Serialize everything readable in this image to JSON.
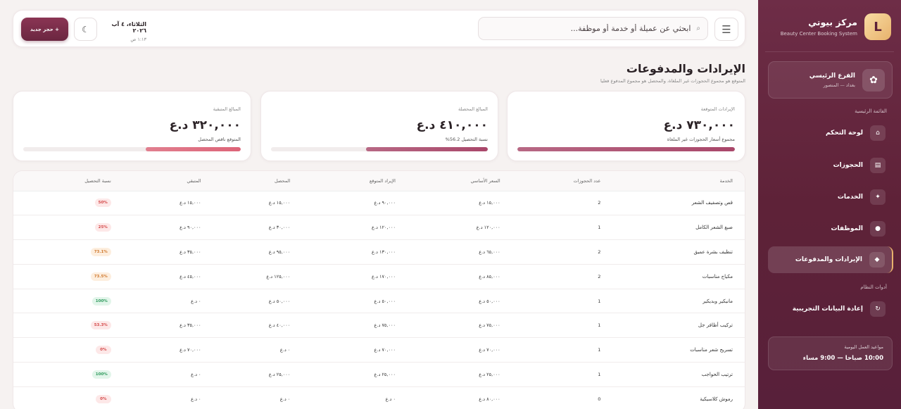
{
  "brand": {
    "name": "مركز بيوتي",
    "subtitle": "Beauty Center Booking System",
    "logo_letter": "L"
  },
  "branch": {
    "name": "الفرع الرئيسي",
    "location": "بغداد — المنصور",
    "icon": "flower-icon"
  },
  "sidebar": {
    "main_section": "القائمة الرئيسية",
    "items": [
      {
        "label": "لوحة التحكم",
        "icon": "home-icon",
        "glyph": "⌂"
      },
      {
        "label": "الحجوزات",
        "icon": "calendar-icon",
        "glyph": "▤"
      },
      {
        "label": "الخدمات",
        "icon": "sparkle-icon",
        "glyph": "✦"
      },
      {
        "label": "الموظفات",
        "icon": "user-icon",
        "glyph": "●"
      },
      {
        "label": "الإيرادات والمدفوعات",
        "icon": "diamond-icon",
        "glyph": "◆"
      }
    ],
    "tools_section": "أدوات النظام",
    "tools": [
      {
        "label": "إعادة البيانات التجريبية",
        "icon": "refresh-icon",
        "glyph": "↻"
      }
    ],
    "hours_label": "مواعيد العمل اليومية",
    "hours_value": "10:00 صباحا — 9:00 مساء"
  },
  "topbar": {
    "search_placeholder": "ابحثي عن عميلة أو خدمة أو موظفة...",
    "date": "الثلاثاء، ٤ آب ٢٠٢٦",
    "time": "١:١٣ ص",
    "new_booking": "+ حجز جديد"
  },
  "page": {
    "title": "الإيرادات والمدفوعات",
    "subtitle": "المتوقع هو مجموع الحجوزات غير الملغاة، والمحصل هو مجموع المدفوع فعليا"
  },
  "cards": [
    {
      "label": "الإيرادات المتوقعة",
      "value": "٧٣٠,٠٠٠ د.ع",
      "note": "مجموع أسعار الحجوزات غير الملغاة",
      "progress": 1.0,
      "color": "#a9476a"
    },
    {
      "label": "المبالغ المحصلة",
      "value": "٤١٠,٠٠٠ د.ع",
      "note": "نسبة التحصيل 56.2%",
      "progress": 0.562,
      "color": "#a9476a"
    },
    {
      "label": "المبالغ المتبقية",
      "value": "٣٢٠,٠٠٠ د.ع",
      "note": "المتوقع ناقص المحصل",
      "progress": 0.438,
      "color": "#dd6478"
    }
  ],
  "table": {
    "headers": [
      "الخدمة",
      "عدد الحجوزات",
      "السعر الأساسي",
      "الإيراد المتوقع",
      "المحصل",
      "المتبقي",
      "نسبة التحصيل"
    ],
    "rows": [
      {
        "service": "قص وتصفيف الشعر",
        "count": "2",
        "base": "١٥,٠٠٠ د.ع",
        "expected": "٩٠,٠٠٠ د.ع",
        "collected": "١٥,٠٠٠ د.ع",
        "remaining": "١٥,٠٠٠ د.ع",
        "rate": "50%",
        "tone": "red"
      },
      {
        "service": "صبغ الشعر الكامل",
        "count": "1",
        "base": "١٢٠,٠٠٠ د.ع",
        "expected": "١٢٠,٠٠٠ د.ع",
        "collected": "٣٠,٠٠٠ د.ع",
        "remaining": "٩٠,٠٠٠ د.ع",
        "rate": "25%",
        "tone": "red"
      },
      {
        "service": "تنظيف بشرة عميق",
        "count": "2",
        "base": "٦٥,٠٠٠ د.ع",
        "expected": "١٣٠,٠٠٠ د.ع",
        "collected": "٩٥,٠٠٠ د.ع",
        "remaining": "٣٥,٠٠٠ د.ع",
        "rate": "73.1%",
        "tone": "orange"
      },
      {
        "service": "مكياج مناسبات",
        "count": "2",
        "base": "٨٥,٠٠٠ د.ع",
        "expected": "١٧٠,٠٠٠ د.ع",
        "collected": "١٢٥,٠٠٠ د.ع",
        "remaining": "٤٥,٠٠٠ د.ع",
        "rate": "73.5%",
        "tone": "orange"
      },
      {
        "service": "مانيكير وبديكير",
        "count": "1",
        "base": "٥٠,٠٠٠ د.ع",
        "expected": "٥٠,٠٠٠ د.ع",
        "collected": "٥٠,٠٠٠ د.ع",
        "remaining": "٠ د.ع",
        "rate": "100%",
        "tone": "green"
      },
      {
        "service": "تركيب أظافر جل",
        "count": "1",
        "base": "٧٥,٠٠٠ د.ع",
        "expected": "٧٥,٠٠٠ د.ع",
        "collected": "٤٠,٠٠٠ د.ع",
        "remaining": "٣٥,٠٠٠ د.ع",
        "rate": "53.3%",
        "tone": "red"
      },
      {
        "service": "تسريح شعر مناسبات",
        "count": "1",
        "base": "٧٠,٠٠٠ د.ع",
        "expected": "٧٠,٠٠٠ د.ع",
        "collected": "٠ د.ع",
        "remaining": "٧٠,٠٠٠ د.ع",
        "rate": "0%",
        "tone": "red"
      },
      {
        "service": "ترتيب الحواجب",
        "count": "1",
        "base": "٢٥,٠٠٠ د.ع",
        "expected": "٢٥,٠٠٠ د.ع",
        "collected": "٢٥,٠٠٠ د.ع",
        "remaining": "٠ د.ع",
        "rate": "100%",
        "tone": "green"
      },
      {
        "service": "رموش كلاسيكية",
        "count": "0",
        "base": "٨٠,٠٠٠ د.ع",
        "expected": "٠ د.ع",
        "collected": "٠ د.ع",
        "remaining": "٠ د.ع",
        "rate": "0%",
        "tone": "red"
      }
    ]
  }
}
